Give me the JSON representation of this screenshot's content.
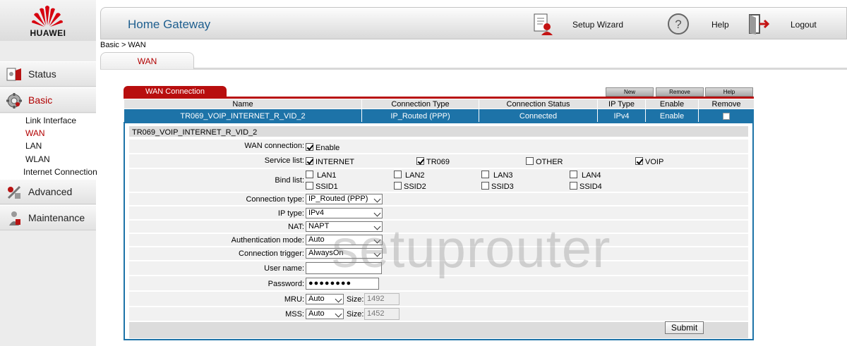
{
  "brand": "HUAWEI",
  "header": {
    "title": "Home Gateway",
    "setup_wizard": "Setup Wizard",
    "help": "Help",
    "logout": "Logout"
  },
  "breadcrumb": "Basic > WAN",
  "tab": "WAN",
  "nav": {
    "status": "Status",
    "basic": "Basic",
    "advanced": "Advanced",
    "maintenance": "Maintenance",
    "basic_sub": [
      "Link Interface",
      "WAN",
      "LAN",
      "WLAN",
      "Internet Connection"
    ]
  },
  "conn": {
    "title": "WAN Connection",
    "btn_new": "New",
    "btn_remove": "Remove",
    "btn_help": "Help",
    "columns": [
      "Name",
      "Connection Type",
      "Connection Status",
      "IP Type",
      "Enable",
      "Remove"
    ],
    "row": [
      "TR069_VOIP_INTERNET_R_VID_2",
      "IP_Routed (PPP)",
      "Connected",
      "IPv4",
      "Enable"
    ]
  },
  "detail": {
    "header": "TR069_VOIP_INTERNET_R_VID_2",
    "wan_connection_label": "WAN connection:",
    "enable_label": "Enable",
    "service_list_label": "Service list:",
    "services": [
      "INTERNET",
      "TR069",
      "OTHER",
      "VOIP"
    ],
    "bind_list_label": "Bind list:",
    "binds": [
      "LAN1",
      "LAN2",
      "LAN3",
      "LAN4",
      "SSID1",
      "SSID2",
      "SSID3",
      "SSID4"
    ],
    "connection_type_label": "Connection type:",
    "connection_type": "IP_Routed (PPP)",
    "ip_type_label": "IP type:",
    "ip_type": "IPv4",
    "nat_label": "NAT:",
    "nat": "NAPT",
    "auth_mode_label": "Authentication mode:",
    "auth_mode": "Auto",
    "conn_trigger_label": "Connection trigger:",
    "conn_trigger": "AlwaysOn",
    "user_name_label": "User name:",
    "user_name": "",
    "password_label": "Password:",
    "password": "●●●●●●●●",
    "mru_label": "MRU:",
    "mru_mode": "Auto",
    "size_label": "Size:",
    "mru_size": "1492",
    "mss_label": "MSS:",
    "mss_mode": "Auto",
    "mss_size": "1452",
    "submit": "Submit"
  },
  "watermark": "setuprouter"
}
